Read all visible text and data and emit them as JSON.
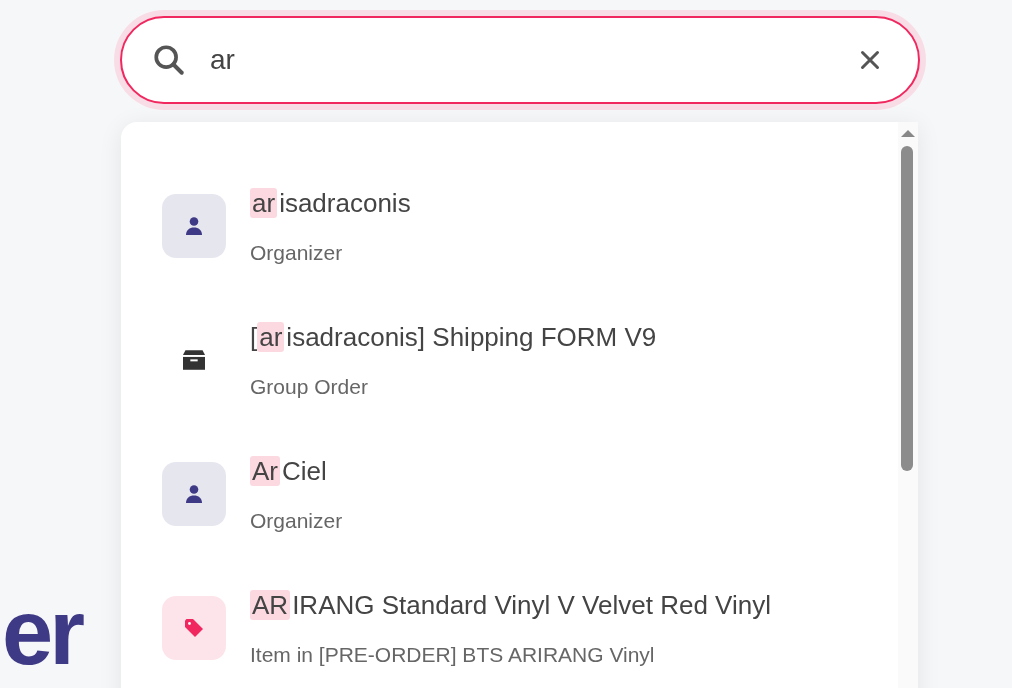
{
  "background_heading": "er",
  "search": {
    "value": "ar"
  },
  "results": [
    {
      "kind": "organizer",
      "title": {
        "match": "ar",
        "after": "isadraconis"
      },
      "subtitle": "Organizer"
    },
    {
      "kind": "group_order",
      "title": {
        "before": "[",
        "match": "ar",
        "after": "isadraconis] Shipping FORM V9"
      },
      "subtitle": "Group Order"
    },
    {
      "kind": "organizer",
      "title": {
        "match": "Ar",
        "after": "Ciel"
      },
      "subtitle": "Organizer"
    },
    {
      "kind": "item",
      "title": {
        "match": "AR",
        "after": "IRANG Standard Vinyl V Velvet Red Vinyl"
      },
      "subtitle": "Item in [PRE-ORDER] BTS ARIRANG Vinyl"
    }
  ]
}
